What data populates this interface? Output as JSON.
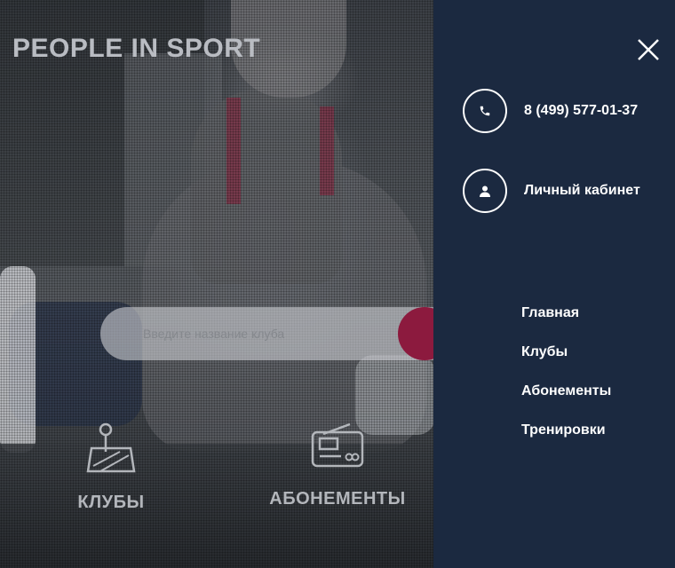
{
  "brand": "PEOPLE IN SPORT",
  "search": {
    "placeholder": "Введите название клуба"
  },
  "categories": {
    "clubs": "КЛУБЫ",
    "subscriptions": "АБОНЕМЕНТЫ"
  },
  "panel": {
    "phone": "8 (499) 577-01-37",
    "cabinet": "Личный кабинет",
    "nav": [
      "Главная",
      "Клубы",
      "Абонементы",
      "Тренировки"
    ]
  },
  "colors": {
    "panel_bg": "#1b2940",
    "accent": "#8c1a3e"
  }
}
